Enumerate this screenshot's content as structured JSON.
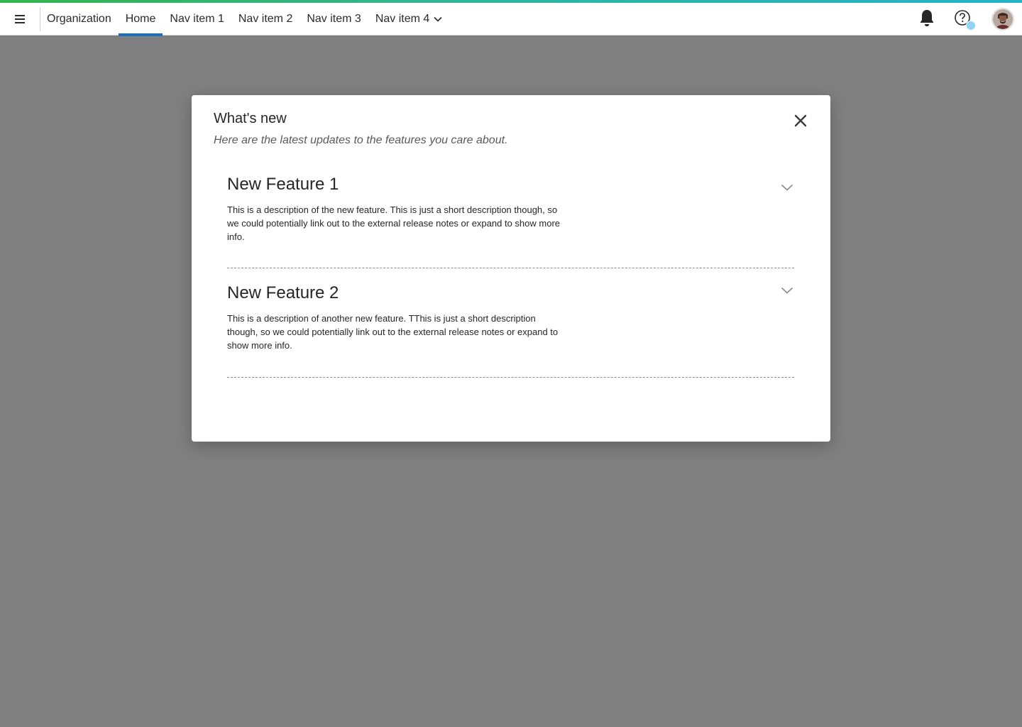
{
  "colors": {
    "accent_gradient_start": "#35b44a",
    "accent_gradient_end": "#25b3c9",
    "active_tab_underline": "#1b6ec2",
    "overlay": "#808080",
    "notification_dot": "#8fd4f5"
  },
  "header": {
    "menu_icon": "hamburger-menu-icon",
    "org_label": "Organization",
    "nav_items": [
      {
        "label": "Home",
        "active": true
      },
      {
        "label": "Nav item 1",
        "active": false
      },
      {
        "label": "Nav item 2",
        "active": false
      },
      {
        "label": "Nav item 3",
        "active": false
      },
      {
        "label": "Nav item 4",
        "active": false,
        "has_dropdown": true
      }
    ],
    "icons": [
      "bell-icon",
      "help-icon",
      "user-avatar"
    ]
  },
  "modal": {
    "title": "What's new",
    "subtitle": "Here are the latest updates to the features you care about.",
    "close_icon": "close-icon",
    "features": [
      {
        "title": "New Feature 1",
        "description": "This is a description of the new feature.  This is just a short description though, so we could potentially link out to the external release notes or expand to show more info."
      },
      {
        "title": "New Feature 2",
        "description": "This is a description of another new feature.  TThis is just a short description though, so we could potentially link out to the external release notes or expand to show more info."
      }
    ]
  }
}
